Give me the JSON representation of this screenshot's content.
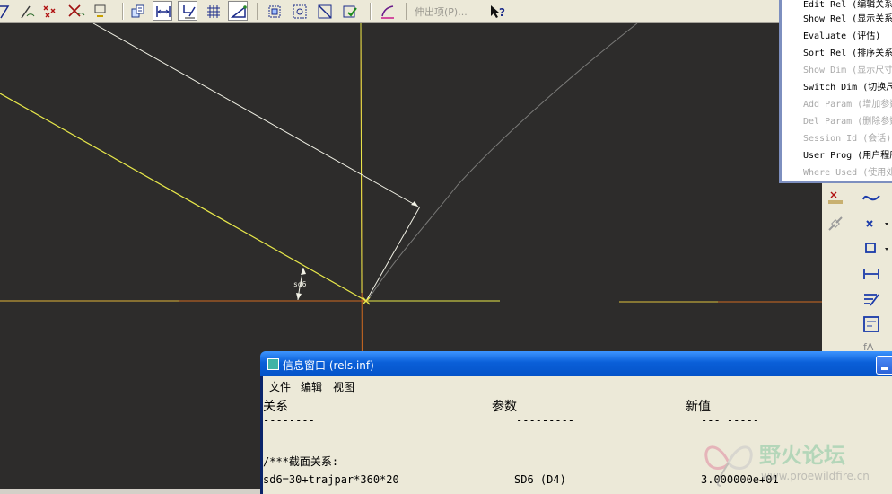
{
  "toolbar": {
    "extend_label": "伸出项(P)...",
    "buttons": [
      {
        "icon": "datum-plane-display-icon"
      },
      {
        "icon": "datum-axis-display-icon"
      },
      {
        "icon": "point-display-icon"
      },
      {
        "icon": "csys-display-icon"
      },
      {
        "icon": "spin-center-icon"
      },
      {
        "icon": "relations-icon"
      },
      {
        "icon": "dimension-display-icon"
      },
      {
        "icon": "constraint-display-icon"
      },
      {
        "icon": "grid-display-icon"
      },
      {
        "icon": "vertex-display-icon"
      },
      {
        "icon": "sketch-orient-icon"
      },
      {
        "icon": "zoom-fit-icon"
      },
      {
        "icon": "repaint-icon"
      },
      {
        "icon": "save-icon"
      },
      {
        "icon": "analysis-icon"
      },
      {
        "icon": "context-help-icon"
      }
    ]
  },
  "relations_menu": {
    "items": [
      {
        "label": "Edit Rel (编辑关系)",
        "enabled": true
      },
      {
        "label": "Show Rel (显示关系)",
        "enabled": true
      },
      {
        "label": "Evaluate (评估)",
        "enabled": true
      },
      {
        "label": "Sort Rel (排序关系)",
        "enabled": true
      },
      {
        "label": "Show Dim (显示尺寸)",
        "enabled": false
      },
      {
        "label": "Switch Dim (切换尺寸)",
        "enabled": true
      },
      {
        "label": "Add Param (增加参数)",
        "enabled": false
      },
      {
        "label": "Del Param (删除参数)",
        "enabled": false
      },
      {
        "label": "Session Id (会话)",
        "enabled": false
      },
      {
        "label": "User Prog (用户程序)",
        "enabled": true
      },
      {
        "label": "Where Used (使用处)",
        "enabled": false
      }
    ]
  },
  "sketch": {
    "dimension_label": "sd6"
  },
  "info_window": {
    "title": "信息窗口 (rels.inf)",
    "menu": {
      "file": "文件",
      "edit": "编辑",
      "view": "视图"
    },
    "headers": {
      "relation": "关系",
      "param": "参数",
      "new_value": "新值"
    },
    "dashes": {
      "relation": "--------",
      "param": "---------",
      "new_value": "--- -----"
    },
    "section_comment": "/***截面关系:",
    "row": {
      "relation": "sd6=30+trajpar*360*20",
      "param": "SD6 (D4)",
      "new_value": "3.000000e+01"
    }
  },
  "watermark": {
    "text": "野火论坛",
    "url": "www.proewildfire.cn"
  },
  "colors": {
    "canvas": "#2d2c2b",
    "sketch_line": "#e8e84a",
    "construction": "#d06a20",
    "title_bar": "#0a5fd8",
    "dim_line": "#f2f2e6"
  }
}
